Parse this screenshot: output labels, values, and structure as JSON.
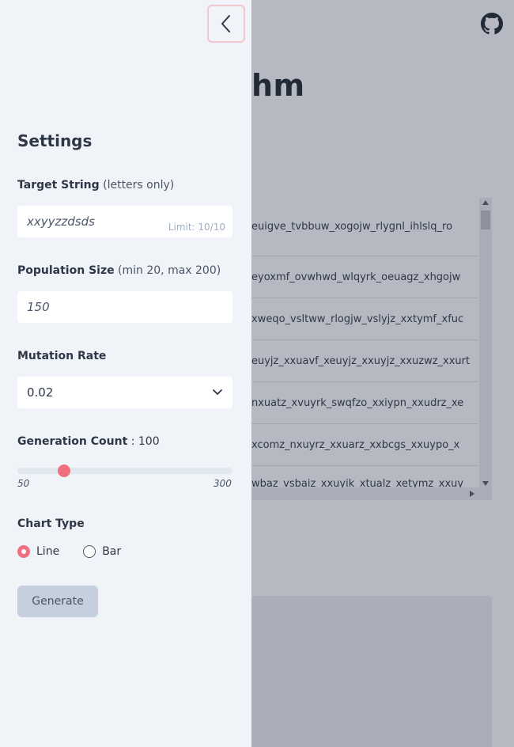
{
  "background": {
    "title_fragment": "hm",
    "table_rows": [
      "euigve_tvbbuw_xogojw_rlygnl_ihlslq_ro",
      "eyoxmf_ovwhwd_wlqyrk_oeuagz_xhgojw",
      "xweqo_vsltww_rlogjw_vslyjz_xxtymf_xfuc",
      "euyjz_xxuavf_xeuyjz_xxuyjz_xxuzwz_xxurt",
      "nxuatz_xvuyrk_swqfzo_xxiypn_xxudrz_xe",
      "xcomz_nxuyrz_xxuarz_xxbcgs_xxuypo_x",
      "wbaz_vsbaiz_xxuyik_xtualz_xetymz_xxuy"
    ]
  },
  "sidebar": {
    "title": "Settings",
    "target": {
      "label": "Target String",
      "hint": "(letters only)",
      "value": "xxyyzzdsds",
      "limit": "Limit: 10/10"
    },
    "population": {
      "label": "Population Size",
      "hint": "(min 20, max 200)",
      "value": "150"
    },
    "mutation": {
      "label": "Mutation Rate",
      "selected": "0.02"
    },
    "generation": {
      "label": "Generation Count",
      "value_text": ": 100",
      "value": 100,
      "min": "50",
      "max": "300"
    },
    "chart_type": {
      "label": "Chart Type",
      "options": [
        "Line",
        "Bar"
      ],
      "selected": "Line"
    },
    "generate_label": "Generate"
  },
  "colors": {
    "accent": "#f07080",
    "sidebar_bg": "#f0f3f8",
    "overlay_bg": "#b6b9c2"
  },
  "icons": {
    "close": "chevron-left-icon",
    "repo": "github-icon",
    "dropdown": "chevron-down-icon"
  }
}
